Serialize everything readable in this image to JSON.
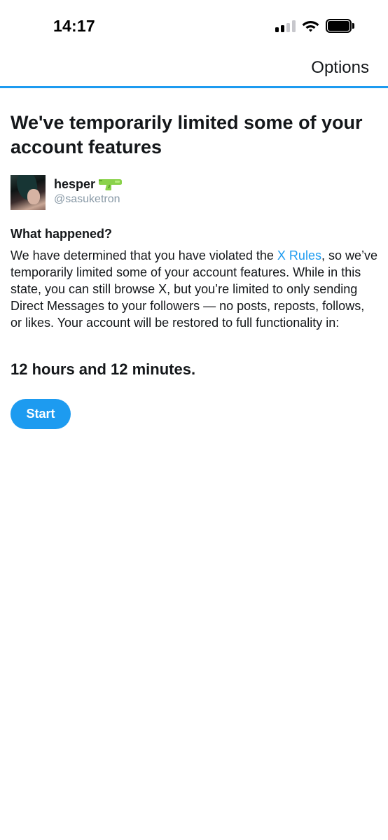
{
  "status_bar": {
    "time": "14:17",
    "signal_icon": "cellular-signal-icon",
    "wifi_icon": "wifi-icon",
    "battery_icon": "battery-icon"
  },
  "nav": {
    "options_label": "Options",
    "accent_color": "#1d9bf0"
  },
  "page": {
    "title": "We've temporarily limited some of your account features"
  },
  "profile": {
    "display_name": "hesper",
    "name_emoji_icon": "water-pistol-icon",
    "handle": "@sasuketron"
  },
  "notice": {
    "heading": "What happened?",
    "text_before_link": "We have determined that you have violated the ",
    "link_text": "X Rules",
    "text_after_link": ", so we’ve temporarily limited some of your account features. While in this state, you can still browse X, but you’re limited to only sending Direct Messages to your followers — no posts, reposts, follows, or likes. Your account will be restored to full functionality in:",
    "countdown": "12 hours and 12 minutes."
  },
  "actions": {
    "start_label": "Start"
  }
}
